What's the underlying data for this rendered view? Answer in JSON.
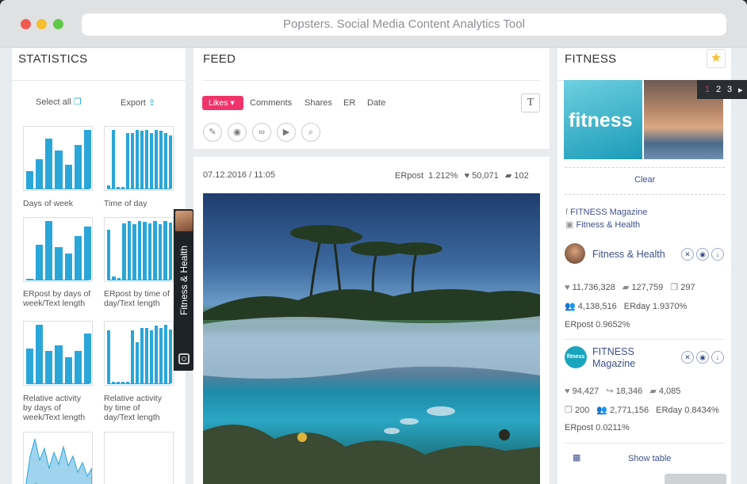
{
  "window": {
    "title": "Popsters. Social Media Content Analytics Tool"
  },
  "statistics": {
    "title": "STATISTICS",
    "select_all": "Select all",
    "export": "Export",
    "charts": [
      {
        "label_lines": [
          "Days of week"
        ],
        "values": [
          0.3,
          0.5,
          0.85,
          0.65,
          0.4,
          0.75,
          1.0
        ]
      },
      {
        "label_lines": [
          "Time of day"
        ],
        "values": [
          0.05,
          1.0,
          0.03,
          0.03,
          0.95,
          0.95,
          1.0,
          0.98,
          1.0,
          0.95,
          1.0,
          0.98,
          0.95,
          0.9
        ]
      },
      {
        "label_lines": [
          "ERpost by days of",
          "week/Text length"
        ],
        "values": [
          0.02,
          0.6,
          1.0,
          0.55,
          0.45,
          0.75,
          0.9
        ]
      },
      {
        "label_lines": [
          "ERpost by time of",
          "day/Text length"
        ],
        "values": [
          0.85,
          0.05,
          0.03,
          0.96,
          1.0,
          0.95,
          1.0,
          0.98,
          0.96,
          1.0,
          0.95,
          1.0,
          0.97
        ]
      },
      {
        "label_lines": [
          "Relative activity",
          "by days of",
          "week/Text length"
        ],
        "values": [
          0.6,
          1.0,
          0.55,
          0.65,
          0.45,
          0.55,
          0.85
        ]
      },
      {
        "label_lines": [
          "Relative activity",
          "by time of",
          "day/Text length"
        ],
        "values": [
          0.9,
          0.03,
          0.03,
          0.03,
          0.03,
          0.9,
          0.7,
          0.95,
          0.95,
          0.9,
          0.98,
          0.95,
          1.0,
          0.92
        ]
      }
    ]
  },
  "feed": {
    "title": "FEED",
    "sort_tabs": [
      "Likes",
      "Comments",
      "Shares",
      "ER",
      "Date"
    ],
    "active_sort": "Likes",
    "text_toggle": "T",
    "post": {
      "date": "07.12.2016 / 11:05",
      "erpost_label": "ERpost",
      "erpost_value": "1.212%",
      "likes": "50,071",
      "comments": "102"
    }
  },
  "side_tab": {
    "label": "Fitness & Health"
  },
  "fitness": {
    "title": "FITNESS",
    "pager": [
      "1",
      "2",
      "3"
    ],
    "active_page": "1",
    "thumb_text": "fitness",
    "clear": "Clear",
    "sources": [
      "FITNESS Magazine",
      "Fitness & Health"
    ],
    "accounts": [
      {
        "name": "Fitness & Health",
        "likes": "11,736,328",
        "comments": "127,759",
        "posts": "297",
        "followers": "4,138,516",
        "erday_label": "ERday",
        "erday": "1.9370%",
        "erpost_label": "ERpost",
        "erpost": "0.9652%"
      },
      {
        "name_line1": "FITNESS",
        "name_line2": "Magazine",
        "avatar_text": "fitness",
        "likes": "94,427",
        "shares": "18,346",
        "comments": "4,085",
        "posts": "200",
        "followers": "2,771,156",
        "erday_label": "ERday",
        "erday": "0.8434%",
        "erpost_label": "ERpost",
        "erpost": "0.0211%"
      }
    ],
    "show_table": "Show table"
  },
  "colors": {
    "accent_pink": "#f0346b",
    "bar_blue": "#2aa6d9",
    "link_navy": "#3f4f8a"
  }
}
